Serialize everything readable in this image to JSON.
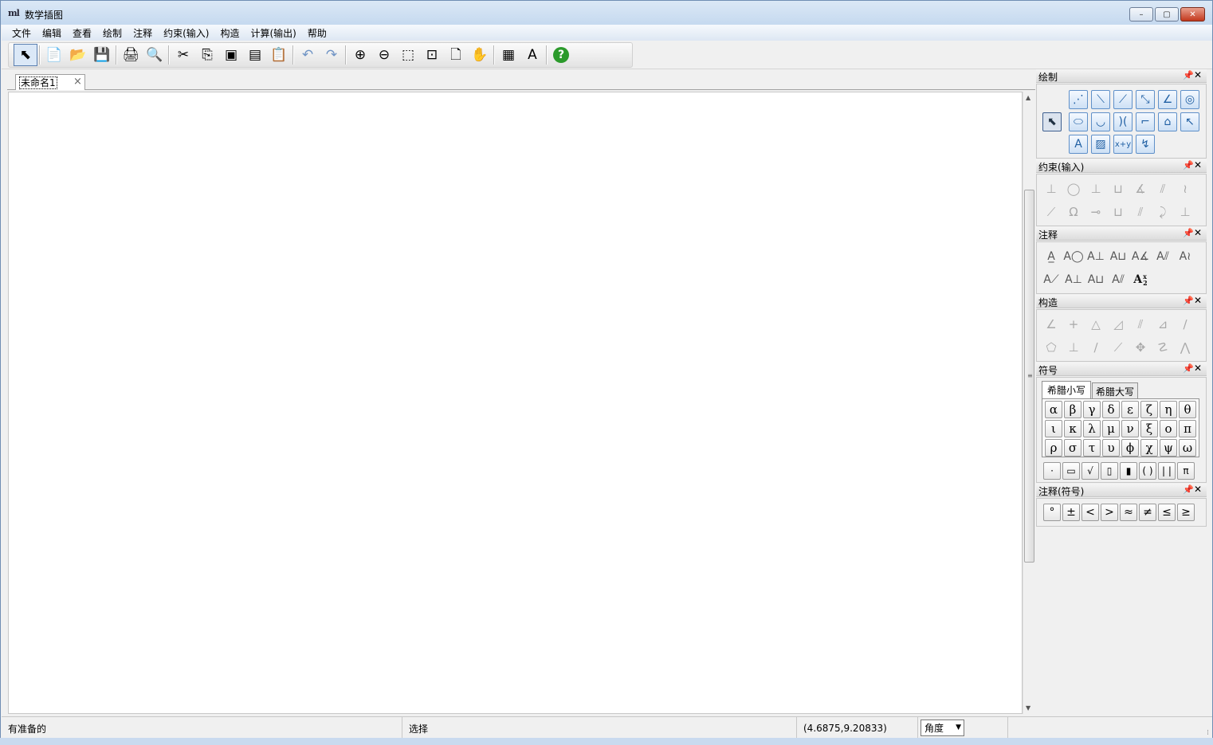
{
  "window": {
    "icon_text": "ml",
    "title": "数学插图",
    "buttons": {
      "minimize": "–",
      "maximize": "▢",
      "close": "✕"
    }
  },
  "menu": [
    "文件",
    "编辑",
    "查看",
    "绘制",
    "注释",
    "约束(输入)",
    "构造",
    "计算(输出)",
    "帮助"
  ],
  "toolbar": [
    {
      "name": "select-arrow-icon",
      "glyph": "⬉"
    },
    {
      "sep": true
    },
    {
      "name": "new-file-icon",
      "glyph": "📄"
    },
    {
      "name": "open-folder-icon",
      "glyph": "📂"
    },
    {
      "name": "save-disk-icon",
      "glyph": "💾"
    },
    {
      "sep": true
    },
    {
      "name": "print-icon",
      "glyph": "🖨"
    },
    {
      "name": "print-preview-icon",
      "glyph": "🔍"
    },
    {
      "sep": true
    },
    {
      "name": "cut-scissors-icon",
      "glyph": "✂"
    },
    {
      "name": "copy-icon",
      "glyph": "⎘"
    },
    {
      "name": "copy-window-icon",
      "glyph": "▣"
    },
    {
      "name": "copy-region-icon",
      "glyph": "▤"
    },
    {
      "name": "paste-clipboard-icon",
      "glyph": "📋"
    },
    {
      "sep": true
    },
    {
      "name": "undo-icon",
      "glyph": "↶"
    },
    {
      "name": "redo-icon",
      "glyph": "↷"
    },
    {
      "sep": true
    },
    {
      "name": "zoom-in-icon",
      "glyph": "⊕"
    },
    {
      "name": "zoom-out-icon",
      "glyph": "⊖"
    },
    {
      "name": "zoom-window-icon",
      "glyph": "⬚"
    },
    {
      "name": "zoom-fit-icon",
      "glyph": "⊡"
    },
    {
      "name": "zoom-page-icon",
      "glyph": "🗋"
    },
    {
      "name": "pan-hand-icon",
      "glyph": "✋"
    },
    {
      "sep": true
    },
    {
      "name": "grid-icon",
      "glyph": "▦"
    },
    {
      "name": "font-style-icon",
      "glyph": "A"
    },
    {
      "sep": true
    },
    {
      "name": "help-question-icon",
      "glyph": "?"
    }
  ],
  "document": {
    "tab_label": "未命名1",
    "tab_close": "×"
  },
  "scrollbar": {
    "up": "▲",
    "down": "▼",
    "grip": "≡"
  },
  "panels": {
    "draw": {
      "title": "绘制",
      "select": {
        "name": "pointer-icon",
        "glyph": "⬉"
      },
      "rows": [
        [
          {
            "name": "point-icon",
            "glyph": "⋰"
          },
          {
            "name": "line-icon",
            "glyph": "⟍"
          },
          {
            "name": "ray-icon",
            "glyph": "⟋"
          },
          {
            "name": "segment-icon",
            "glyph": "⤡"
          },
          {
            "name": "angle-icon",
            "glyph": "∠"
          },
          {
            "name": "circle-icon",
            "glyph": "◎"
          }
        ],
        [
          {
            "name": "ellipse-icon",
            "glyph": "⬭"
          },
          {
            "name": "parabola-icon",
            "glyph": "◡"
          },
          {
            "name": "hyperbola-icon",
            "glyph": ")("
          },
          {
            "name": "polyline-icon",
            "glyph": "⌐"
          },
          {
            "name": "polygon-icon",
            "glyph": "⌂"
          },
          {
            "name": "curve-icon",
            "glyph": "↖"
          }
        ],
        [
          {
            "name": "text-label-icon",
            "glyph": "A"
          },
          {
            "name": "image-icon",
            "glyph": "▨"
          },
          {
            "name": "function-graph-icon",
            "glyph": "x+y"
          },
          {
            "name": "locus-icon",
            "glyph": "↯"
          }
        ]
      ]
    },
    "constraint": {
      "title": "约束(输入)",
      "rows": [
        [
          "⊥",
          "◯",
          "⊥",
          "⊔",
          "∡",
          "⫽",
          "≀"
        ],
        [
          "⟋",
          "Ω",
          "⊸",
          "⊔",
          "⫽",
          "⤸",
          "⊥"
        ]
      ]
    },
    "annotation": {
      "title": "注释",
      "rows": [
        [
          "A̲",
          "A◯",
          "A⊥",
          "A⊔",
          "A∡",
          "A⫽",
          "A≀"
        ],
        [
          "A⟋",
          "A⊥",
          "A⊔",
          "A⫽"
        ]
      ],
      "subscript": {
        "big": "A",
        "small_top": "x",
        "small_bottom": "2"
      }
    },
    "construct": {
      "title": "构造",
      "rows": [
        [
          "∠",
          "+",
          "△",
          "◿",
          "⫽",
          "⊿",
          "∕"
        ],
        [
          "⬠",
          "⊥",
          "∕",
          "⟋",
          "✥",
          "☡",
          "⋀"
        ]
      ]
    },
    "symbol": {
      "title": "符号",
      "tabs": [
        "希腊小写",
        "希腊大写"
      ],
      "greek": [
        [
          "α",
          "β",
          "γ",
          "δ",
          "ε",
          "ζ",
          "η",
          "θ"
        ],
        [
          "ι",
          "κ",
          "λ",
          "μ",
          "ν",
          "ξ",
          "ο",
          "π"
        ],
        [
          "ρ",
          "σ",
          "τ",
          "υ",
          "ϕ",
          "χ",
          "ψ",
          "ω"
        ]
      ],
      "format": [
        {
          "name": "dot-format-icon",
          "glyph": "·"
        },
        {
          "name": "fraction-format-icon",
          "glyph": "▭"
        },
        {
          "name": "sqrt-format-icon",
          "glyph": "√"
        },
        {
          "name": "superscript-format-icon",
          "glyph": "▯"
        },
        {
          "name": "subscript-format-icon",
          "glyph": "▮"
        },
        {
          "name": "parenthesis-format-icon",
          "glyph": "( )"
        },
        {
          "name": "absolute-format-icon",
          "glyph": "| |"
        },
        {
          "name": "pi-format-icon",
          "glyph": "π"
        }
      ]
    },
    "annotation_symbol": {
      "title": "注释(符号)",
      "symbols": [
        "°",
        "±",
        "<",
        ">",
        "≈",
        "≠",
        "≤",
        "≥"
      ]
    },
    "pin": "📌",
    "close": "✕"
  },
  "status": {
    "message": "有准备的",
    "mode": "选择",
    "coords": "(4.6875,9.20833)",
    "unit_selected": "角度",
    "unit_arrow": "▼",
    "grip": "⁞"
  }
}
